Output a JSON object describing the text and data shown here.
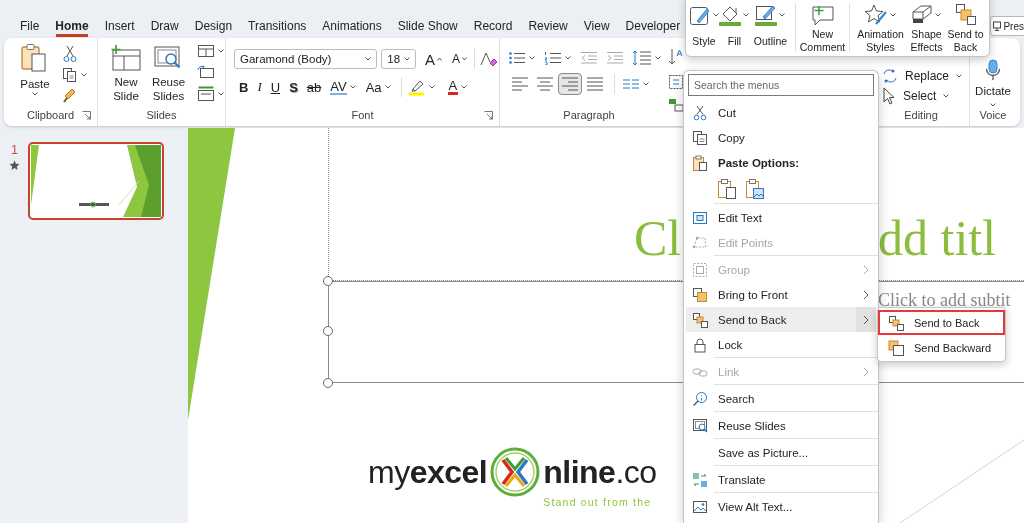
{
  "tabs": [
    {
      "label": "File",
      "selected": false
    },
    {
      "label": "Home",
      "selected": true
    },
    {
      "label": "Insert",
      "selected": false
    },
    {
      "label": "Draw",
      "selected": false
    },
    {
      "label": "Design",
      "selected": false
    },
    {
      "label": "Transitions",
      "selected": false
    },
    {
      "label": "Animations",
      "selected": false
    },
    {
      "label": "Slide Show",
      "selected": false
    },
    {
      "label": "Record",
      "selected": false
    },
    {
      "label": "Review",
      "selected": false
    },
    {
      "label": "View",
      "selected": false
    },
    {
      "label": "Developer",
      "selected": false
    }
  ],
  "present_button": {
    "label": "Pres"
  },
  "ribbon": {
    "clipboard": {
      "paste": "Paste",
      "label": "Clipboard"
    },
    "slides": {
      "new_slide": "New Slide",
      "reuse_slides": "Reuse Slides",
      "label": "Slides"
    },
    "font": {
      "font_name": "Garamond (Body)",
      "font_size": "18",
      "grow": "A",
      "shrink": "A",
      "format_buttons": [
        {
          "kind": "bold",
          "text": "B"
        },
        {
          "kind": "italic",
          "text": "I"
        },
        {
          "kind": "underline",
          "text": "U"
        },
        {
          "kind": "shadow",
          "text": "S"
        },
        {
          "kind": "strikethrough",
          "text": "ab"
        },
        {
          "kind": "spacing",
          "text": "AV"
        },
        {
          "kind": "case",
          "text": "Aa"
        }
      ],
      "font_color": "A",
      "label": "Font"
    },
    "paragraph": {
      "alignments": [
        {
          "selected": false
        },
        {
          "selected": false
        },
        {
          "selected": true
        },
        {
          "selected": false
        }
      ],
      "label": "Paragraph"
    },
    "editing": {
      "replace": "Replace",
      "select": "Select",
      "label": "Editing"
    },
    "voice": {
      "dictate": "Dictate",
      "label": "Voice"
    }
  },
  "slides": [
    {
      "number": "1",
      "selected": true
    }
  ],
  "slide": {
    "title_fragments": [
      "Cl",
      "dd titl"
    ],
    "subtitle": "Click to add subtit",
    "logo": {
      "wordmark_start": "my**excel**",
      "wordmark_end": "**nline**.co",
      "tagline": "Stand out from the"
    }
  },
  "mini_toolbar": {
    "groups": [
      {
        "buttons": [
          {
            "label": "Style",
            "dropdown": true
          },
          {
            "label": "Fill",
            "dropdown": true
          },
          {
            "label": "Outline",
            "dropdown": true
          }
        ]
      },
      {
        "buttons": [
          {
            "label": "New Comment",
            "dropdown": false
          }
        ]
      },
      {
        "buttons": [
          {
            "label": "Animation Styles",
            "dropdown": true
          },
          {
            "label": "Shape Effects",
            "dropdown": true
          },
          {
            "label": "Send to Back",
            "dropdown": false
          }
        ]
      }
    ]
  },
  "context_menu": {
    "search_placeholder": "Search the menus",
    "items": [
      {
        "kind": "command",
        "label": "Cut",
        "disabled": false,
        "submenu": false,
        "selected": false
      },
      {
        "kind": "command",
        "label": "Copy",
        "disabled": false,
        "submenu": false,
        "selected": false
      },
      {
        "kind": "header",
        "label": "Paste Options:"
      },
      {
        "kind": "paste_options"
      },
      {
        "kind": "separator"
      },
      {
        "kind": "command",
        "label": "Edit Text",
        "disabled": false,
        "submenu": false,
        "selected": false
      },
      {
        "kind": "command",
        "label": "Edit Points",
        "disabled": true,
        "submenu": false,
        "selected": false
      },
      {
        "kind": "separator"
      },
      {
        "kind": "command",
        "label": "Group",
        "disabled": true,
        "submenu": true,
        "selected": false
      },
      {
        "kind": "command",
        "label": "Bring to Front",
        "disabled": false,
        "submenu": true,
        "selected": false
      },
      {
        "kind": "command",
        "label": "Send to Back",
        "disabled": false,
        "submenu": true,
        "selected": true
      },
      {
        "kind": "command",
        "label": "Lock",
        "disabled": false,
        "submenu": false,
        "selected": false
      },
      {
        "kind": "separator"
      },
      {
        "kind": "command",
        "label": "Link",
        "disabled": true,
        "submenu": true,
        "selected": false
      },
      {
        "kind": "separator"
      },
      {
        "kind": "command",
        "label": "Search",
        "disabled": false,
        "submenu": false,
        "selected": false
      },
      {
        "kind": "separator"
      },
      {
        "kind": "command",
        "label": "Reuse Slides",
        "disabled": false,
        "submenu": false,
        "selected": false
      },
      {
        "kind": "separator"
      },
      {
        "kind": "command",
        "label": "Save as Picture...",
        "disabled": false,
        "submenu": false,
        "selected": false
      },
      {
        "kind": "separator"
      },
      {
        "kind": "command",
        "label": "Translate",
        "disabled": false,
        "submenu": false,
        "selected": false
      },
      {
        "kind": "separator"
      },
      {
        "kind": "command",
        "label": "View Alt Text...",
        "disabled": false,
        "submenu": false,
        "selected": false
      }
    ]
  },
  "submenu": {
    "items": [
      {
        "label": "Send to Back",
        "selected": true
      },
      {
        "label": "Send Backward",
        "selected": false
      }
    ]
  }
}
